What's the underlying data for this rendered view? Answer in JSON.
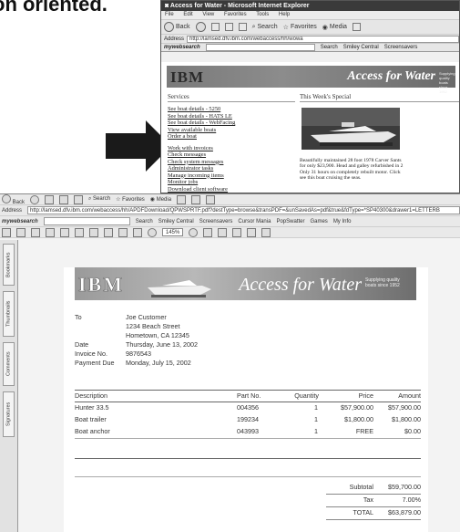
{
  "slide": {
    "heading_fragment": "on oriented."
  },
  "browser": {
    "title": "Access for Water - Microsoft Internet Explorer",
    "menu": [
      "File",
      "Edit",
      "View",
      "Favorites",
      "Tools",
      "Help"
    ],
    "toolbar": {
      "back": "Back",
      "search": "Search",
      "favorites": "Favorites",
      "media": "Media"
    },
    "address_label": "Address",
    "address": "http://lamsed.dfv.ibm.com/webaccess/hh/wowa",
    "search_bar": {
      "brand": "mywebsearch",
      "search": "Search",
      "smiley": "Smiley Central",
      "screensavers": "Screensavers"
    },
    "page": {
      "logo": "IBM",
      "banner_title": "Access for Water",
      "banner_tagline": "Supplying quality boats since 1952",
      "services_heading": "Services",
      "services_links": [
        "See boat details - 5250",
        "See boat details - HATS LE",
        "See boat details - WebFacing",
        "View available boats",
        "Order a boat"
      ],
      "admin_links": [
        "Work with invoices",
        "Check messages",
        "Check system messages",
        "Administrator tasks",
        "Manage incoming items",
        "Monitor jobs",
        "Download client software"
      ],
      "special_heading": "This Week's Special",
      "special_text": [
        "Beautifully maintained 28 foot 1978 Carver Sants",
        "for only $23,900. Head and galley refurbished in 2",
        "Only 31 hours on completely rebuilt motor. Click",
        "see this boat cruising the seas."
      ]
    }
  },
  "pdf_viewer": {
    "address_label": "Address",
    "address": "http://lamsed.dfv.ibm.com/webaccess/hh/APDFDownload/QPWSPRTF.pdf?destType=browse&transPDF=&unSavedAs=pdf&true&fdType=*SP40300&drawer1=LETTERB",
    "toolbar": {
      "back": "Back",
      "search": "Search",
      "favorites": "Favorites",
      "media": "Media"
    },
    "search_bar": {
      "brand": "mywebsearch",
      "search": "Search",
      "smiley": "Smiley Central",
      "screensavers": "Screensavers",
      "cursor": "Cursor Mania",
      "popswatter": "PopSwatter",
      "games": "Games",
      "myinfo": "My Info"
    },
    "zoom": "145%",
    "side_tabs": [
      "Bookmarks",
      "Thumbnails",
      "Comments",
      "Signatures"
    ],
    "invoice": {
      "logo": "IBM",
      "banner_title": "Access for Water",
      "banner_tagline": "Supplying quality boats since 1952",
      "labels": {
        "to": "To",
        "date": "Date",
        "invoice_no": "Invoice No.",
        "payment_due": "Payment Due"
      },
      "to_lines": [
        "Joe Customer",
        "1234 Beach Street",
        "Hometown, CA 12345"
      ],
      "date": "Thursday, June 13, 2002",
      "invoice_no": "9876543",
      "payment_due": "Monday, July 15, 2002",
      "columns": {
        "description": "Description",
        "part_no": "Part No.",
        "quantity": "Quantity",
        "price": "Price",
        "amount": "Amount"
      },
      "items": [
        {
          "description": "Hunter 33.5",
          "part_no": "004356",
          "quantity": "1",
          "price": "$57,900.00",
          "amount": "$57,900.00"
        },
        {
          "description": "Boat trailer",
          "part_no": "199234",
          "quantity": "1",
          "price": "$1,800.00",
          "amount": "$1,800.00"
        },
        {
          "description": "Boat anchor",
          "part_no": "043993",
          "quantity": "1",
          "price": "FREE",
          "amount": "$0.00"
        }
      ],
      "totals": {
        "subtotal_label": "Subtotal",
        "subtotal": "$59,700.00",
        "tax_label": "Tax",
        "tax": "7.00%",
        "total_label": "TOTAL",
        "total": "$63,879.00"
      }
    }
  }
}
